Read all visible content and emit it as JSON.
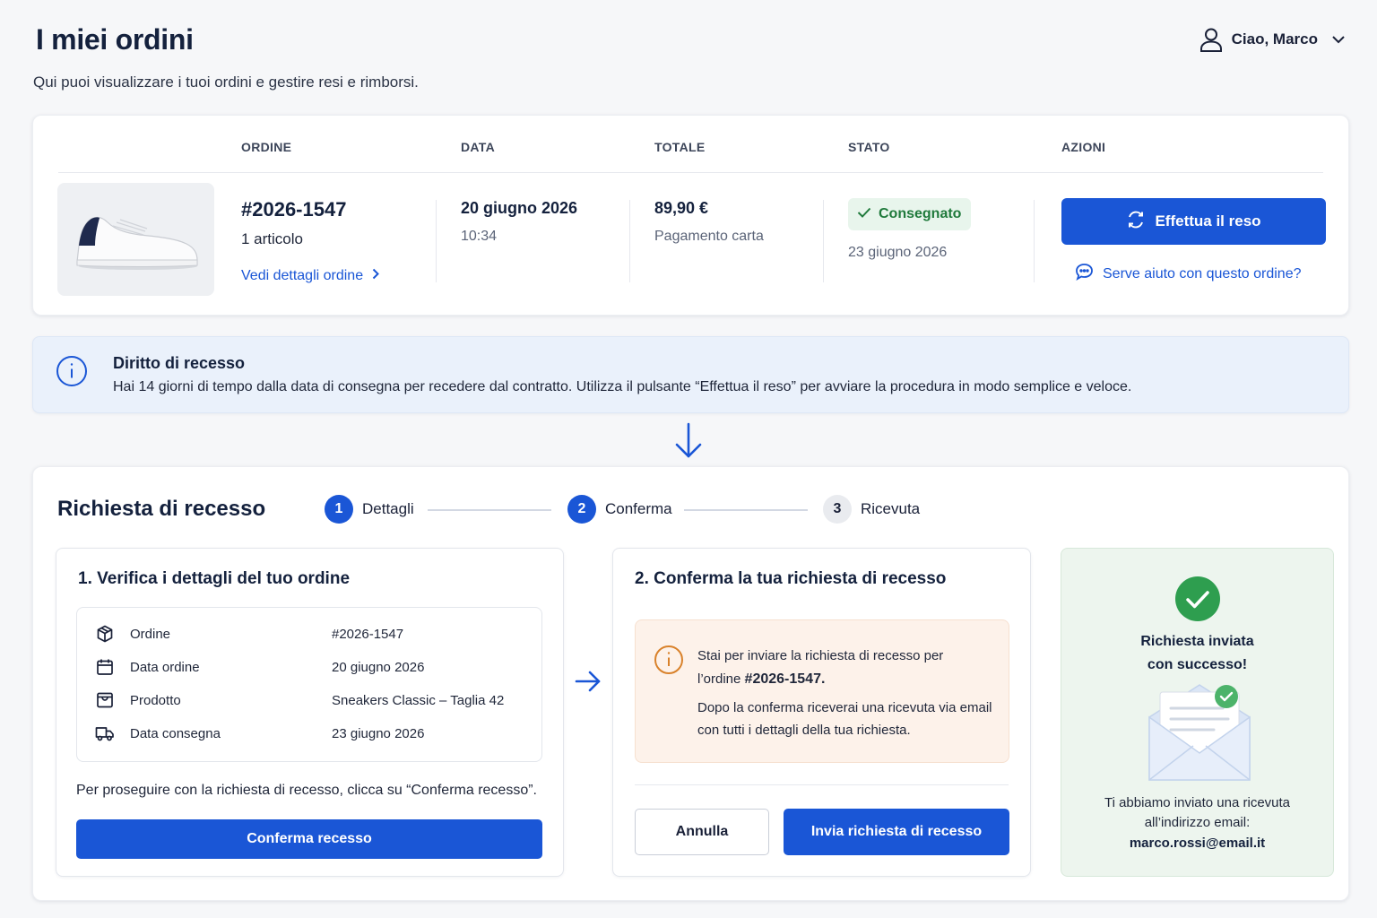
{
  "header": {
    "title": "I miei ordini",
    "subtitle": "Qui puoi visualizzare i tuoi ordini e gestire resi e rimborsi.",
    "user_greeting": "Ciao, Marco"
  },
  "orders_table": {
    "columns": [
      "ORDINE",
      "DATA",
      "TOTALE",
      "STATO",
      "AZIONI"
    ],
    "order": {
      "number": "#2026-1547",
      "items": "1 articolo",
      "details_link": "Vedi dettagli ordine",
      "date": "20 giugno 2026",
      "time": "10:34",
      "total": "89,90 €",
      "payment": "Pagamento carta",
      "status": "Consegnato",
      "status_date": "23 giugno 2026",
      "return_button": "Effettua il reso",
      "help_link": "Serve aiuto con questo ordine?"
    }
  },
  "info_banner": {
    "title": "Diritto di recesso",
    "text": "Hai 14 giorni di tempo dalla data di consegna per recedere dal contratto. Utilizza il pulsante “Effettua il reso” per avviare la procedura in modo semplice e veloce."
  },
  "withdrawal": {
    "title": "Richiesta di recesso",
    "steps": [
      {
        "number": "1",
        "label": "Dettagli",
        "state": "active"
      },
      {
        "number": "2",
        "label": "Conferma",
        "state": "active"
      },
      {
        "number": "3",
        "label": "Ricevuta",
        "state": "inactive"
      }
    ],
    "verify": {
      "title": "1. Verifica i dettagli del tuo ordine",
      "rows": [
        {
          "icon": "box-icon",
          "label": "Ordine",
          "value": "#2026-1547"
        },
        {
          "icon": "calendar-icon",
          "label": "Data ordine",
          "value": "20 giugno 2026"
        },
        {
          "icon": "product-icon",
          "label": "Prodotto",
          "value": "Sneakers Classic – Taglia 42"
        },
        {
          "icon": "truck-icon",
          "label": "Data consegna",
          "value": "23 giugno 2026"
        }
      ],
      "proceed_text": "Per proseguire con la richiesta di recesso, clicca su “Conferma recesso”.",
      "confirm_button": "Conferma recesso"
    },
    "confirm": {
      "title": "2. Conferma la tua richiesta di recesso",
      "warning_line1": "Stai per inviare la richiesta di recesso per",
      "warning_line2_prefix": "l’ordine",
      "warning_order": "#2026-1547.",
      "warning_detail": "Dopo la conferma riceverai una ricevuta via email con tutti i dettagli della tua richiesta.",
      "cancel_button": "Annulla",
      "send_button": "Invia richiesta di recesso"
    },
    "receipt": {
      "title_line1": "Richiesta inviata",
      "title_line2": "con successo!",
      "text_line1": "Ti abbiamo inviato una ricevuta",
      "text_line2": "all’indirizzo email:",
      "email": "marco.rossi@email.it"
    }
  },
  "colors": {
    "primary": "#1a56d6",
    "success": "#2e9e4f",
    "warning": "#d9822b",
    "info_bg": "#eaf1fb"
  }
}
